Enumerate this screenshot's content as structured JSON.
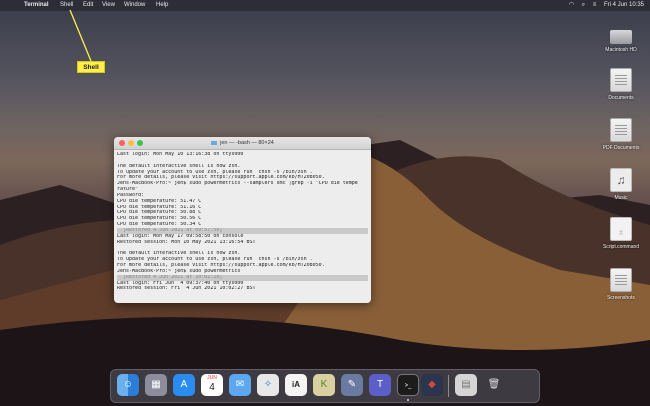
{
  "menubar": {
    "apple": "",
    "items": [
      "Terminal",
      "Shell",
      "Edit",
      "View",
      "Window",
      "Help"
    ],
    "datetime": "Fri 4 Jun  10:35"
  },
  "callout": {
    "label": "Shell"
  },
  "desktop_icons": [
    {
      "name": "Macintosh HD",
      "icon": "hard-drive-icon"
    },
    {
      "name": "Documents",
      "icon": "document-icon"
    },
    {
      "name": "PDF Documents",
      "icon": "document-icon"
    },
    {
      "name": "Music",
      "icon": "music-icon"
    },
    {
      "name": "Script.command",
      "icon": "script-icon"
    },
    {
      "name": "Screenshots",
      "icon": "folder-icon"
    }
  ],
  "terminal": {
    "title": "jen — -bash — 80×24",
    "lines": [
      "Last login: Mon May 10 13:16:38 on ttys000",
      "",
      "The default interactive shell is now zsh.",
      "To update your account to use zsh, please run `chsh -s /bin/zsh`.",
      "For more details, please visit https://support.apple.com/kb/HT208050.",
      "Jens-MacBook-Pro:~ jen$ sudo powermetrics --samplers smc |grep -i \"CPU die tempe",
      "rature\"",
      "Password:",
      "CPU die temperature: 51.47 C",
      "CPU die temperature: 51.16 C",
      "CPU die temperature: 50.88 C",
      "CPU die temperature: 50.56 C",
      "CPU die temperature: 50.34 C",
      "  [Restored 4 Jun 2021 at 09:57:50]",
      "Last login: Mon May 17 09:58:50 on console",
      "Restored session: Mon 10 May 2021 13:16:54 BST",
      "",
      "The default interactive shell is now zsh.",
      "To update your account to use zsh, please run `chsh -s /bin/zsh`.",
      "For more details, please visit https://support.apple.com/kb/HT208050.",
      "Jens-MacBook-Pro:~ jen$ sudo powermetrics",
      "  [Restored 4 Jun 2021 at 10:02:28]",
      "Last login: Fri Jun  4 09:37:40 on ttys000",
      "Restored session: Fri  4 Jun 2021 10:02:27 BST"
    ]
  },
  "dock": {
    "calendar_month": "JUN",
    "calendar_day": "4",
    "textedit_label": "iA",
    "items": [
      {
        "icon": "finder-icon",
        "color": "#3b8fe0"
      },
      {
        "icon": "launchpad-icon",
        "color": "#8a8a9a"
      },
      {
        "icon": "app-store-icon",
        "color": "#2a8cf0"
      },
      {
        "icon": "calendar-icon",
        "color": "#ffffff"
      },
      {
        "icon": "mail-icon",
        "color": "#5ba7f0"
      },
      {
        "icon": "safari-icon",
        "color": "#3a9df0"
      },
      {
        "icon": "ia-writer-icon",
        "color": "#f4f4f4"
      },
      {
        "icon": "scrivener-icon",
        "color": "#d0c090"
      },
      {
        "icon": "notes-icon",
        "color": "#6a7aa0"
      },
      {
        "icon": "teams-icon",
        "color": "#5b5fc7"
      },
      {
        "icon": "terminal-icon",
        "color": "#1c1c1c"
      },
      {
        "icon": "screenshot-app-icon",
        "color": "#d04a3a"
      },
      {
        "icon": "recent-folder-icon",
        "color": "#cfcfcf"
      },
      {
        "icon": "trash-icon",
        "color": "#d9d9d9"
      }
    ]
  }
}
